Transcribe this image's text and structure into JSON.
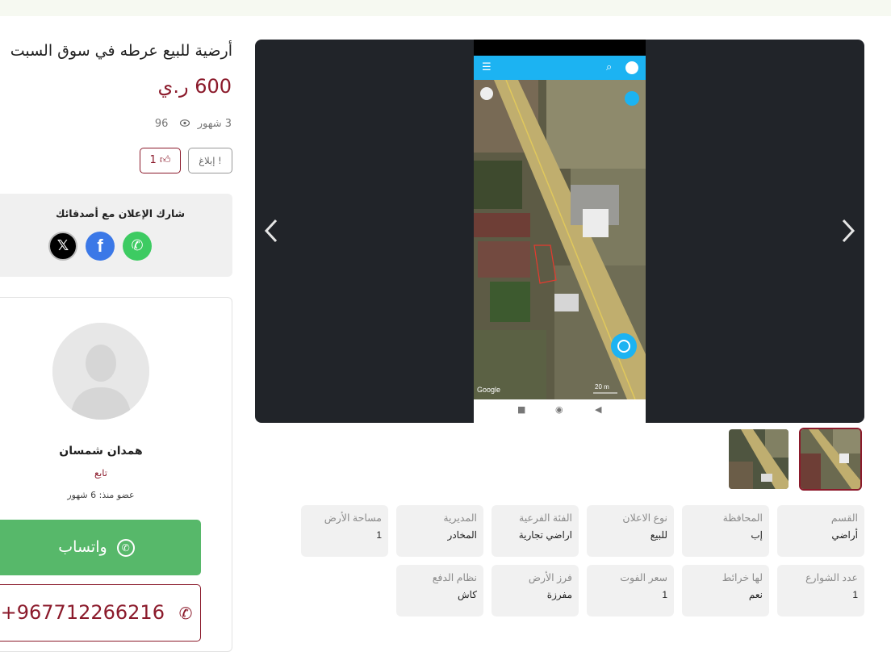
{
  "listing": {
    "title": "أرضية للبيع عرطه في سوق السبت",
    "price": "600 ر.ي",
    "age": "3 شهور",
    "views": "96",
    "likes": "1",
    "report_label": "إبلاغ"
  },
  "gallery": {
    "prev_icon": "chevron-left-icon",
    "next_icon": "chevron-right-icon",
    "map_watermark": "Google",
    "map_scale": "20 m",
    "active_thumb": 1
  },
  "details": [
    {
      "label": "القسم",
      "value": "أراضي"
    },
    {
      "label": "المحافظة",
      "value": "إب"
    },
    {
      "label": "نوع الاعلان",
      "value": "للبيع"
    },
    {
      "label": "الفئة الفرعية",
      "value": "اراضي تجارية"
    },
    {
      "label": "المديرية",
      "value": "المخادر"
    },
    {
      "label": "مساحة الأرض",
      "value": "1"
    },
    {
      "label": "عدد الشوارع",
      "value": "1"
    },
    {
      "label": "لها خرائط",
      "value": "نعم"
    },
    {
      "label": "سعر الفوت",
      "value": "1"
    },
    {
      "label": "فرز الأرض",
      "value": "مفرزة"
    },
    {
      "label": "نظام الدفع",
      "value": "كاش"
    }
  ],
  "share": {
    "title": "شارك الإعلان مع أصدقائك",
    "networks": [
      "x-icon",
      "facebook-icon",
      "whatsapp-icon"
    ]
  },
  "seller": {
    "name": "همدان شمسان",
    "role": "تابع",
    "member_since": "عضو منذ: 6 شهور",
    "whatsapp_label": "واتساب",
    "phone": "+967712266216"
  },
  "colors": {
    "brand": "#8b1a2b",
    "whatsapp": "#57b86a",
    "app_bar": "#1cb3f2"
  }
}
